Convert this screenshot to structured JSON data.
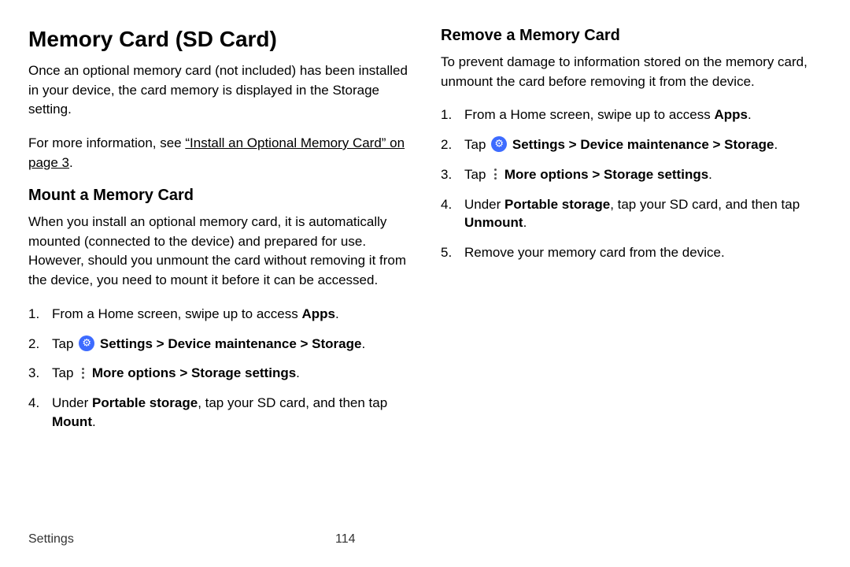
{
  "left": {
    "title": "Memory Card (SD Card)",
    "intro": "Once an optional memory card (not included) has been installed in your device, the card memory is displayed in the Storage setting.",
    "moreinfo_pre": "For more information, see ",
    "moreinfo_link": "“Install an Optional Memory Card” on page 3",
    "moreinfo_post": ".",
    "sub1_title": "Mount a Memory Card",
    "sub1_intro": "When you install an optional memory card, it is automatically mounted (connected to the device) and prepared for use. However, should you unmount the card without removing it from the device, you need to mount it before it can be accessed.",
    "steps": {
      "n1": "1.",
      "s1a": "From a Home screen, swipe up to access ",
      "s1b": "Apps",
      "s1c": ".",
      "n2": "2.",
      "s2a": "Tap ",
      "s2b": "Settings",
      "s2c": " > ",
      "s2d": "Device maintenance",
      "s2e": " > ",
      "s2f": "Storage",
      "s2g": ".",
      "n3": "3.",
      "s3a": "Tap ",
      "s3b": "More options",
      "s3c": " > ",
      "s3d": "Storage settings",
      "s3e": ".",
      "n4": "4.",
      "s4a": "Under ",
      "s4b": "Portable storage",
      "s4c": ", tap your SD card, and then tap ",
      "s4d": "Mount",
      "s4e": "."
    }
  },
  "right": {
    "title": "Remove a Memory Card",
    "intro": "To prevent damage to information stored on the memory card, unmount the card before removing it from the device.",
    "steps": {
      "n1": "1.",
      "s1a": "From a Home screen, swipe up to access ",
      "s1b": "Apps",
      "s1c": ".",
      "n2": "2.",
      "s2a": "Tap ",
      "s2b": "Settings",
      "s2c": " > ",
      "s2d": "Device maintenance",
      "s2e": " > ",
      "s2f": "Storage",
      "s2g": ".",
      "n3": "3.",
      "s3a": "Tap ",
      "s3b": "More options",
      "s3c": " > ",
      "s3d": "Storage settings",
      "s3e": ".",
      "n4": "4.",
      "s4a": "Under ",
      "s4b": "Portable storage",
      "s4c": ", tap your SD card, and then tap ",
      "s4d": "Unmount",
      "s4e": ".",
      "n5": "5.",
      "s5a": "Remove your memory card from the device."
    }
  },
  "footer": {
    "section": "Settings",
    "page": "114"
  }
}
